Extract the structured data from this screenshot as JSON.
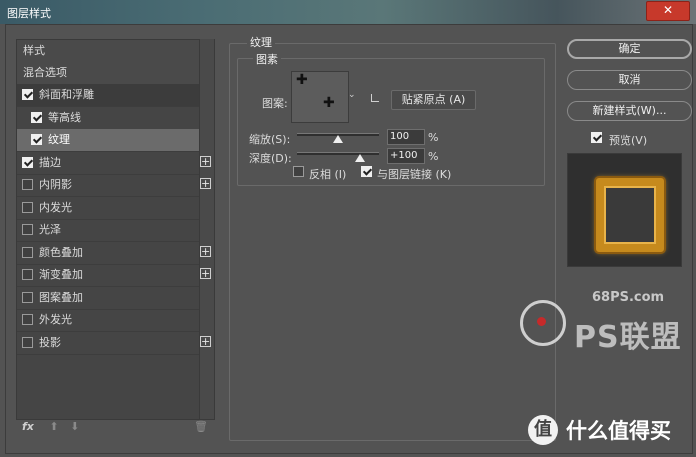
{
  "window": {
    "title": "图层样式",
    "close_icon": "close-icon"
  },
  "left_panel": {
    "header_styles": "样式",
    "header_blend": "混合选项",
    "items": [
      {
        "label": "斜面和浮雕",
        "checked": true,
        "plus": false,
        "indent": false
      },
      {
        "label": "等高线",
        "checked": true,
        "plus": false,
        "indent": true
      },
      {
        "label": "纹理",
        "checked": true,
        "plus": false,
        "indent": true,
        "selected": true
      },
      {
        "label": "描边",
        "checked": true,
        "plus": true,
        "indent": false
      },
      {
        "label": "内阴影",
        "checked": false,
        "plus": true,
        "indent": false
      },
      {
        "label": "内发光",
        "checked": false,
        "plus": false,
        "indent": false
      },
      {
        "label": "光泽",
        "checked": false,
        "plus": false,
        "indent": false
      },
      {
        "label": "颜色叠加",
        "checked": false,
        "plus": true,
        "indent": false
      },
      {
        "label": "渐变叠加",
        "checked": false,
        "plus": true,
        "indent": false
      },
      {
        "label": "图案叠加",
        "checked": false,
        "plus": false,
        "indent": false
      },
      {
        "label": "外发光",
        "checked": false,
        "plus": false,
        "indent": false
      },
      {
        "label": "投影",
        "checked": false,
        "plus": true,
        "indent": false
      }
    ],
    "footer": {
      "fx": "fx",
      "up_icon": "arrow-up-icon",
      "down_icon": "arrow-down-icon",
      "trash_icon": "trash-icon"
    }
  },
  "texture": {
    "group_title": "纹理",
    "subgroup_title": "图素",
    "pattern_label": "图案:",
    "snap_button": "贴紧原点 (A)",
    "scale_label": "缩放(S):",
    "scale_value": "100",
    "depth_label": "深度(D):",
    "depth_value": "+100",
    "percent": "%",
    "invert_label": "反相 (I)",
    "invert_checked": false,
    "link_label": "与图层链接 (K)",
    "link_checked": true
  },
  "right": {
    "ok": "确定",
    "cancel": "取消",
    "new_style": "新建样式(W)...",
    "preview_label": "预览(V)",
    "preview_checked": true
  },
  "watermark": {
    "site": "68PS.com",
    "brand": "PS联盟",
    "smzdm": "什么值得买",
    "smzdm_badge": "值"
  }
}
